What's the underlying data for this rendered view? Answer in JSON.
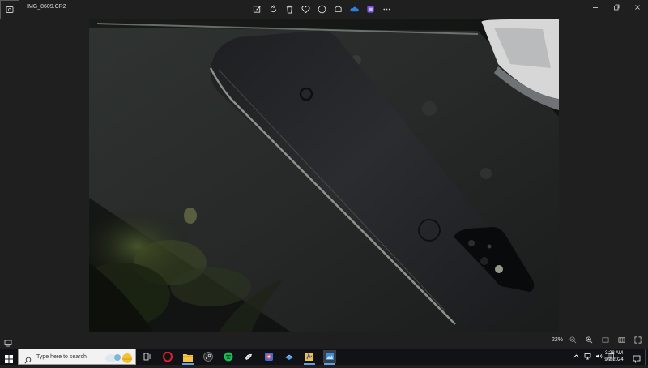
{
  "window": {
    "file_name": "IMG_8609.CR2",
    "app_icon": "photos-app-icon",
    "toolbar_icons": [
      "edit-icon",
      "rotate-icon",
      "delete-icon",
      "favorite-icon",
      "info-icon",
      "crop-icon",
      "onedrive-icon",
      "clipchamp-icon",
      "more-icon"
    ],
    "controls": [
      "minimize-icon",
      "maximize-icon",
      "close-icon"
    ]
  },
  "viewer": {
    "zoom": "22%",
    "status_icons": [
      "zoom-out-icon",
      "zoom-in-icon",
      "fit-window-icon",
      "filmstrip-icon",
      "fullscreen-icon"
    ]
  },
  "taskbar": {
    "search_placeholder": "Type here to search",
    "apps": [
      "task-view-icon",
      "opera-icon",
      "file-explorer-icon",
      "steam-dark-icon",
      "spotify-icon",
      "app-icon",
      "copilot-icon",
      "steam-icon",
      "photos-tray-icon",
      "photos-icon"
    ],
    "tray_icons": [
      "chevron-up-icon",
      "network-icon",
      "volume-icon",
      "language-icon"
    ],
    "time": "3:28 AM",
    "date": "9/2/2024"
  },
  "colors": {
    "background": "#1f1f1f",
    "taskbar": "#101216",
    "accent": "#5ea0e8"
  }
}
